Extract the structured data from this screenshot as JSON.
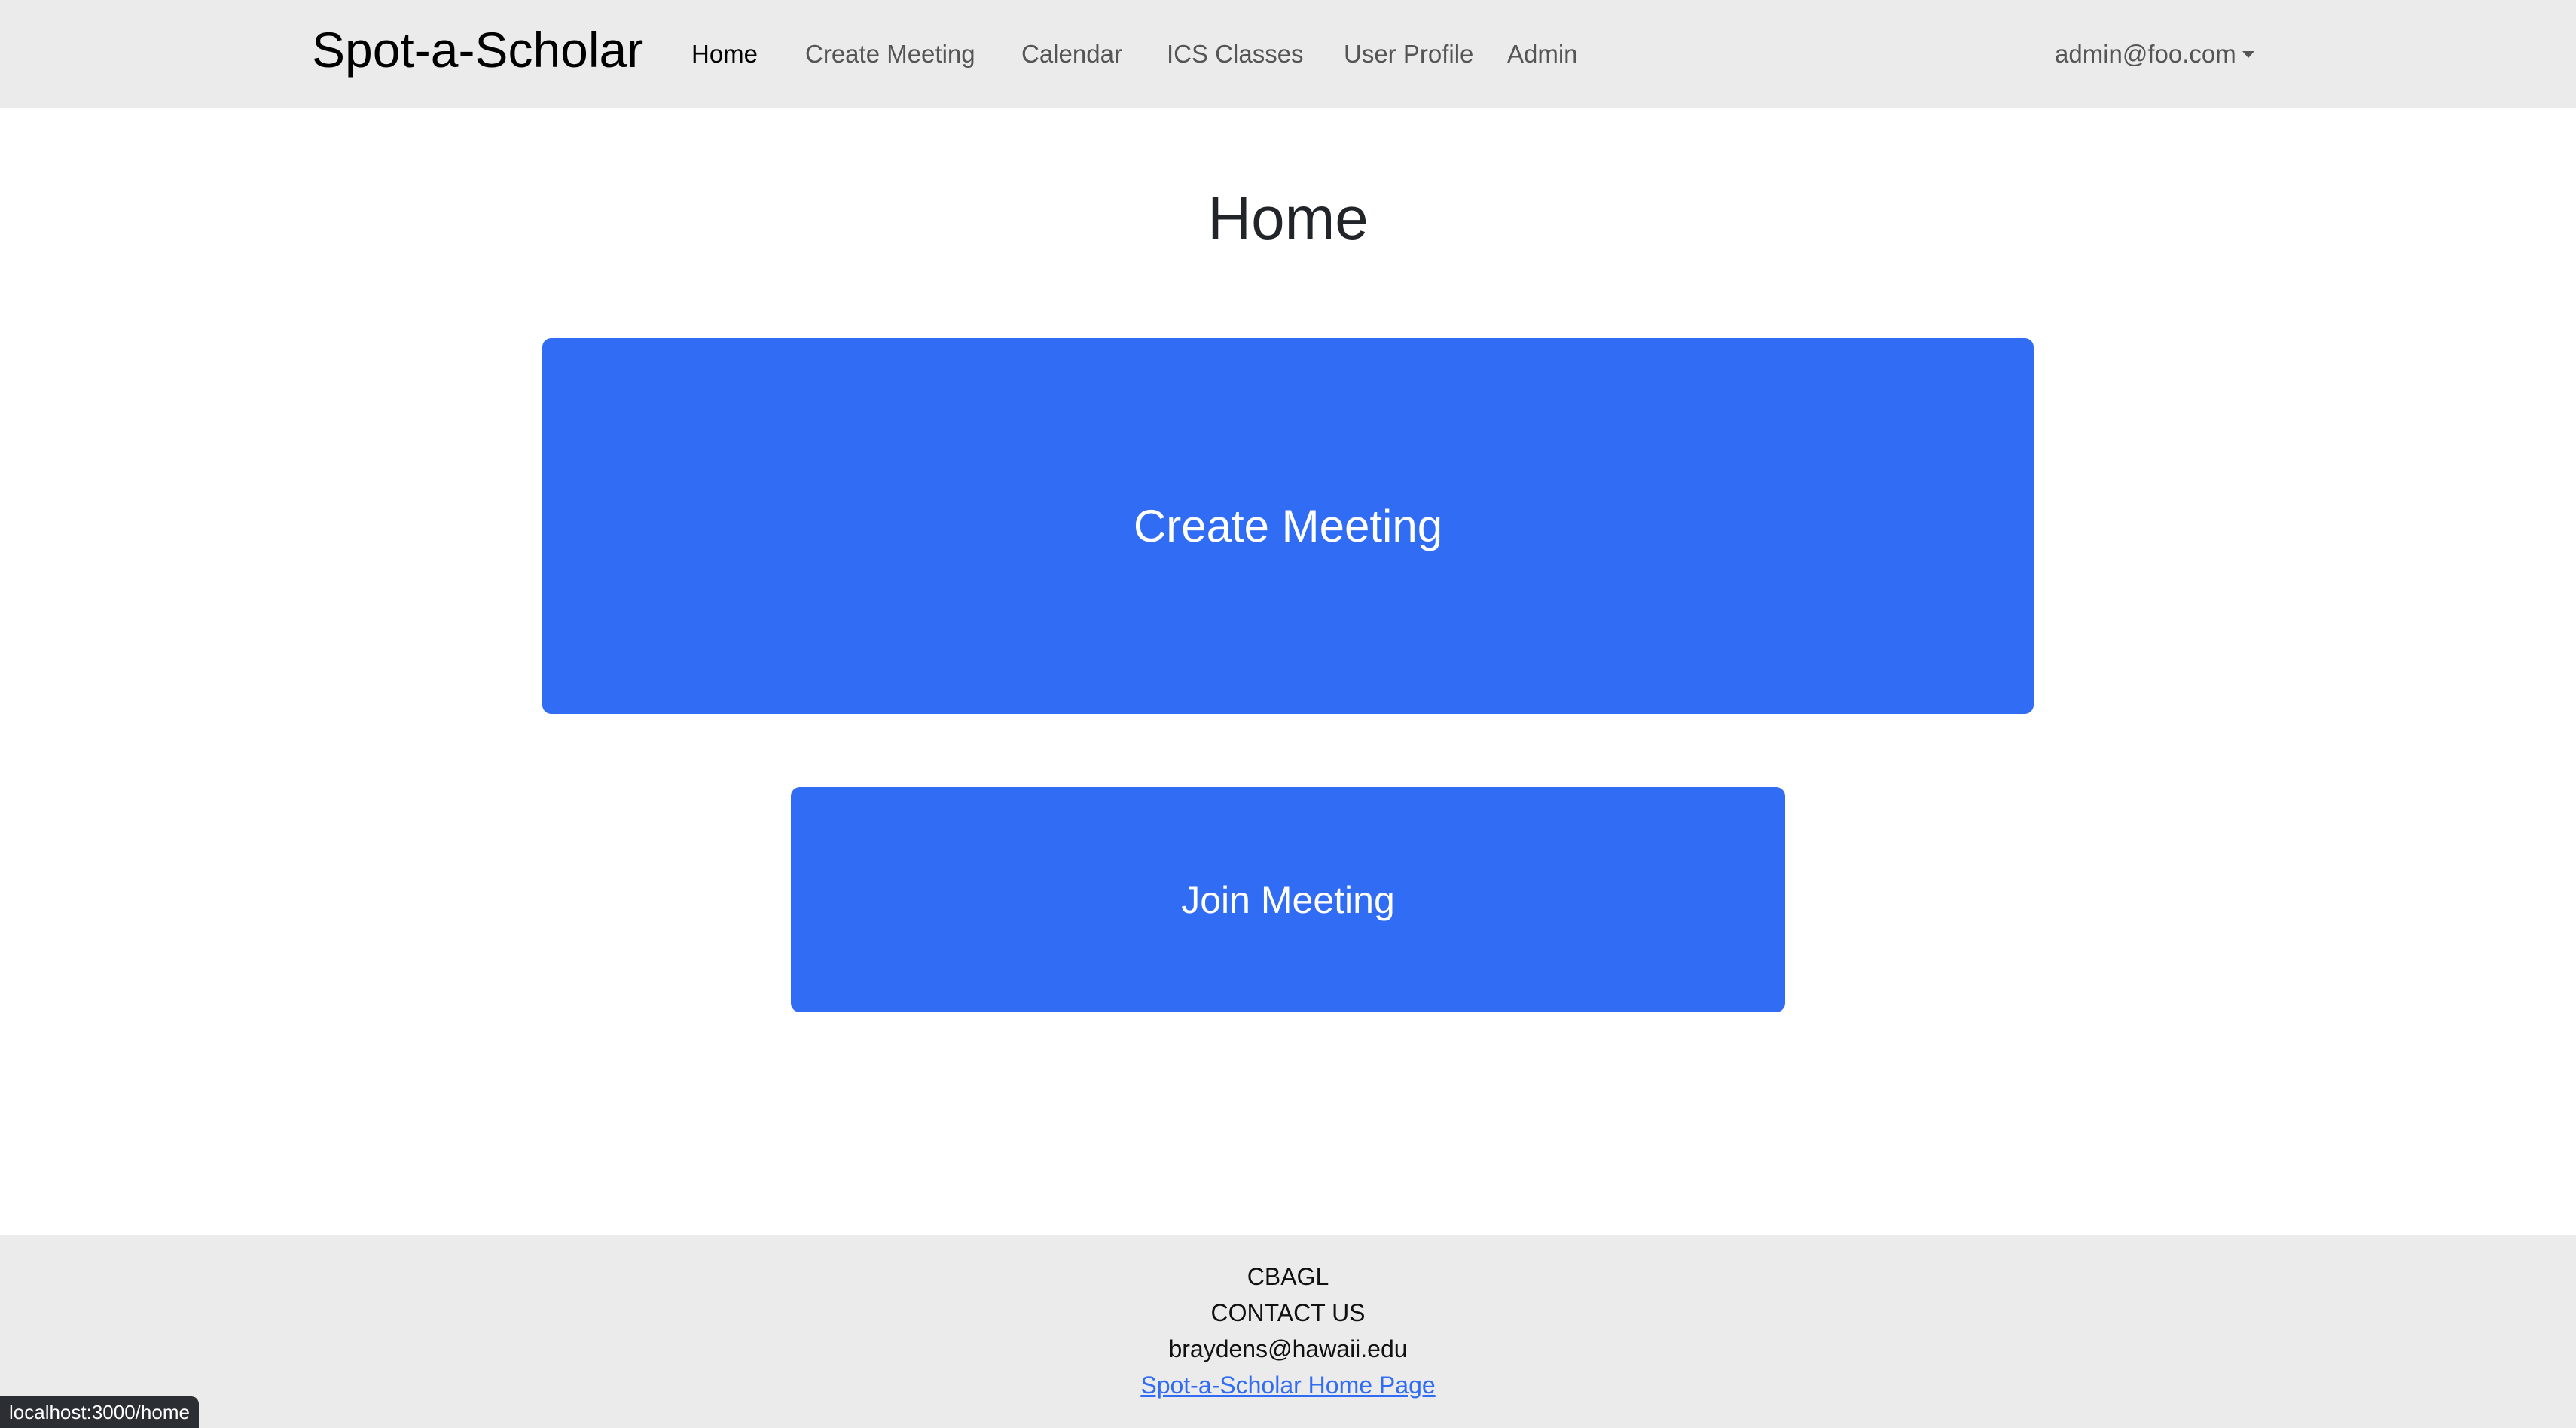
{
  "navbar": {
    "brand": "Spot-a-Scholar",
    "links": [
      {
        "label": "Home",
        "active": true
      },
      {
        "label": "Create Meeting",
        "active": false
      },
      {
        "label": "Calendar",
        "active": false
      },
      {
        "label": "ICS Classes",
        "active": false
      },
      {
        "label": "User Profile",
        "active": false
      },
      {
        "label": "Admin",
        "active": false
      }
    ],
    "user": "admin@foo.com"
  },
  "main": {
    "title": "Home",
    "create_button": "Create Meeting",
    "join_button": "Join Meeting"
  },
  "footer": {
    "org": "CBAGL",
    "contact": "CONTACT US",
    "email": "braydens@hawaii.edu",
    "link": "Spot-a-Scholar Home Page"
  },
  "status_bar": {
    "url": "localhost:3000/home"
  },
  "colors": {
    "primary": "#316cf4",
    "navbar_bg": "#ebebeb",
    "footer_bg": "#ebebeb"
  }
}
